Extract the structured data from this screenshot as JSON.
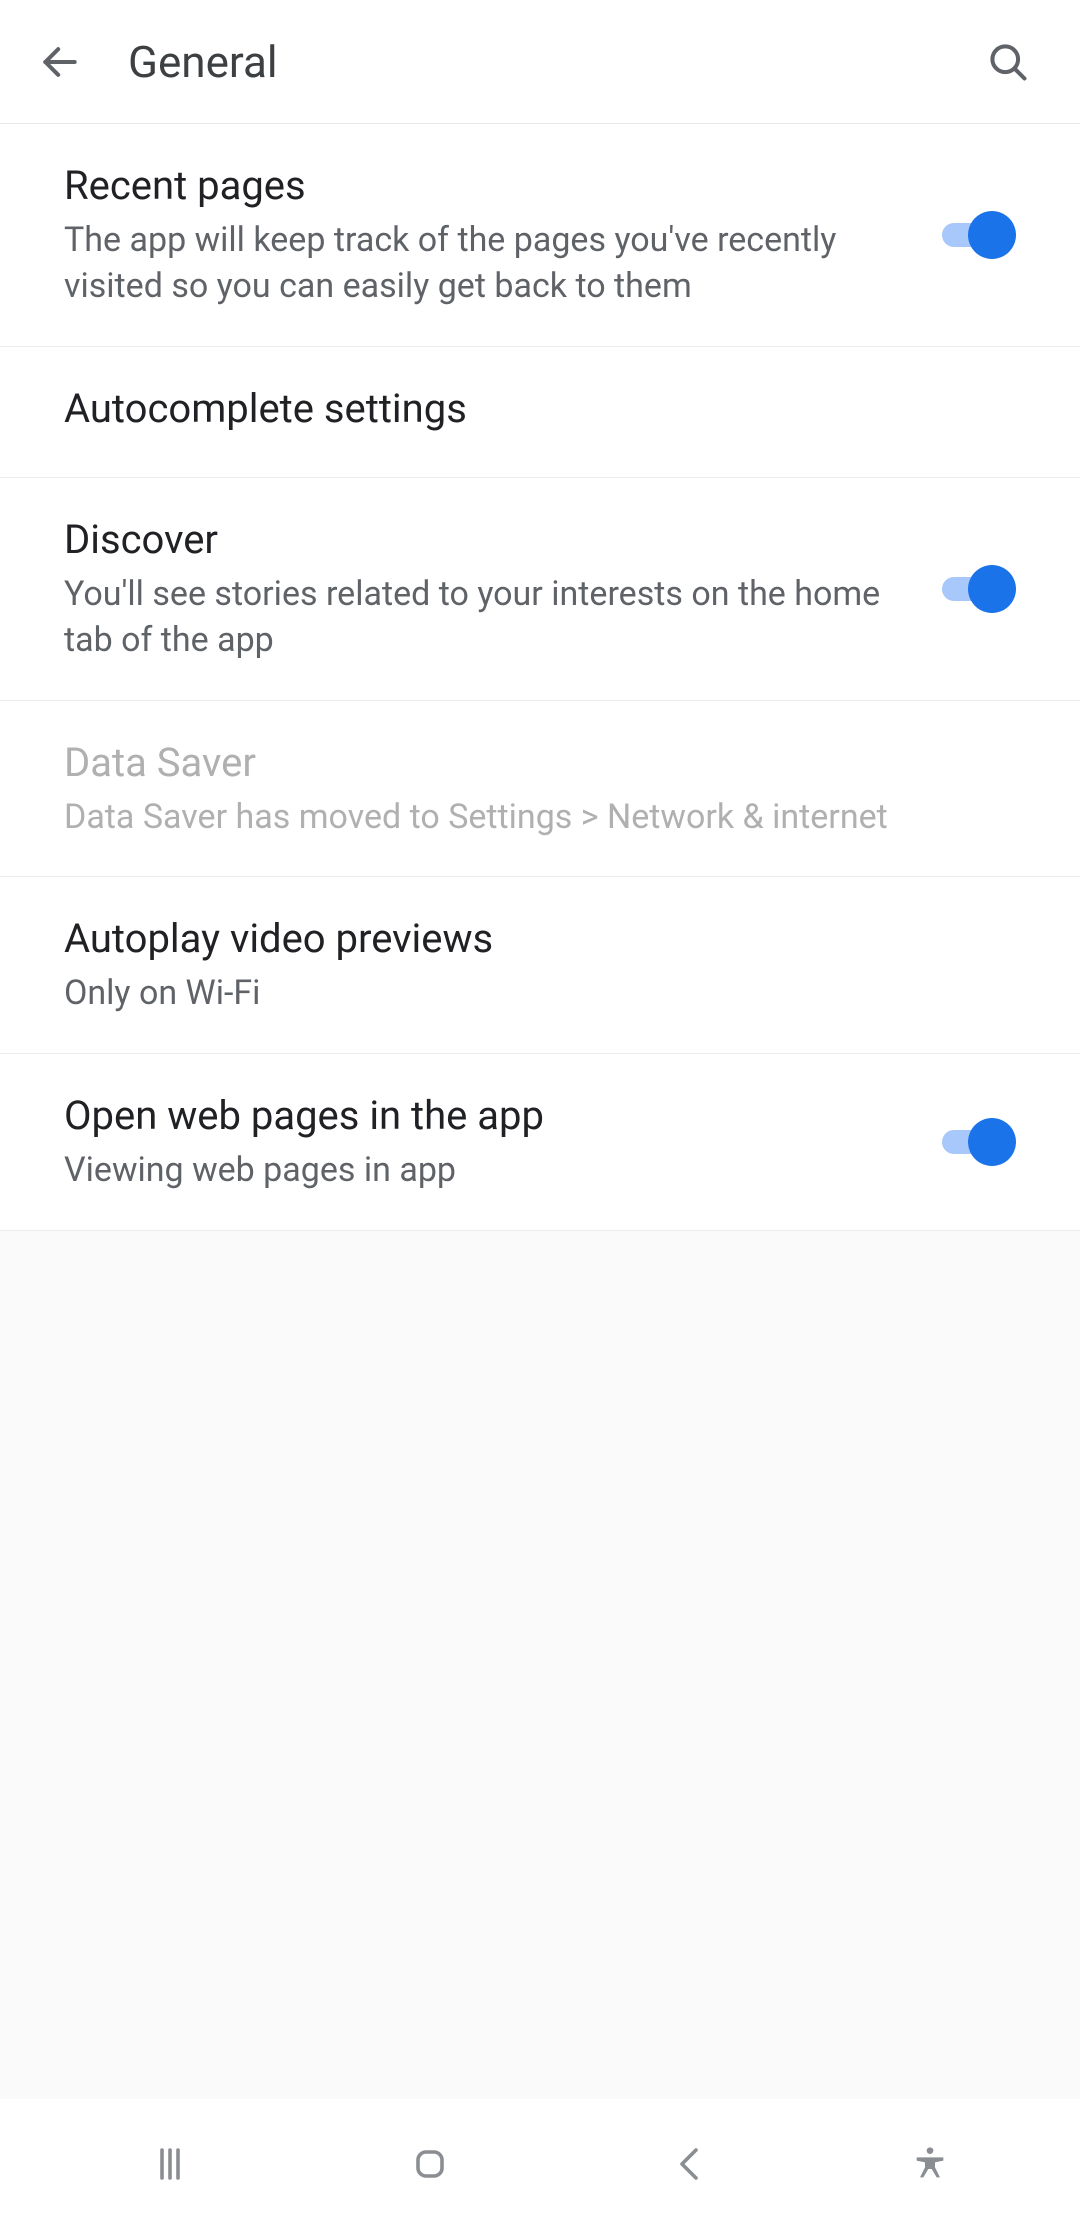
{
  "header": {
    "title": "General"
  },
  "settings": [
    {
      "title": "Recent pages",
      "subtitle": "The app will keep track of the pages you've recently visited so you can easily get back to them",
      "toggle": true
    },
    {
      "title": "Autocomplete settings"
    },
    {
      "title": "Discover",
      "subtitle": "You'll see stories related to your interests on the home tab of the app",
      "toggle": true
    },
    {
      "title": "Data Saver",
      "subtitle": "Data Saver has moved to Settings > Network & internet"
    },
    {
      "title": "Autoplay video previews",
      "subtitle": "Only on Wi-Fi"
    },
    {
      "title": "Open web pages in the app",
      "subtitle": "Viewing web pages in app",
      "toggle": true
    }
  ]
}
